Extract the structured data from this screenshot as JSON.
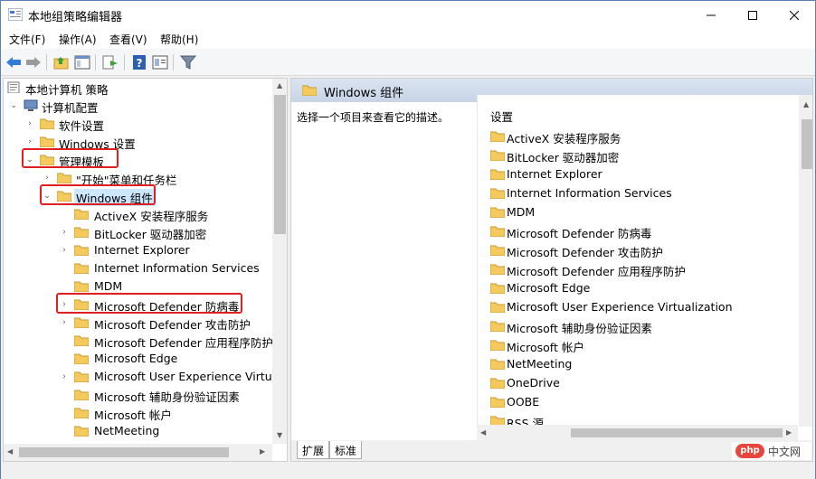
{
  "window": {
    "title": "本地组策略编辑器"
  },
  "menubar": {
    "items": [
      "文件(F)",
      "操作(A)",
      "查看(V)",
      "帮助(H)"
    ]
  },
  "toolbar": {
    "icons": [
      "back-icon",
      "forward-icon",
      "up-folder-icon",
      "show-hide-tree-icon",
      "export-icon",
      "help-icon",
      "properties-icon",
      "filter-icon"
    ]
  },
  "tree": {
    "items": [
      {
        "label": "本地计算机 策略",
        "icon": "computer-policy-icon"
      },
      {
        "label": "计算机配置",
        "icon": "computer-icon"
      },
      {
        "label": "软件设置"
      },
      {
        "label": "Windows 设置"
      },
      {
        "label": "管理模板"
      },
      {
        "label": "\"开始\"菜单和任务栏"
      },
      {
        "label": "Windows 组件"
      },
      {
        "label": "ActiveX 安装程序服务"
      },
      {
        "label": "BitLocker 驱动器加密"
      },
      {
        "label": "Internet Explorer"
      },
      {
        "label": "Internet Information Services"
      },
      {
        "label": "MDM"
      },
      {
        "label": "Microsoft Defender 防病毒"
      },
      {
        "label": "Microsoft Defender 攻击防护"
      },
      {
        "label": "Microsoft Defender 应用程序防护"
      },
      {
        "label": "Microsoft Edge"
      },
      {
        "label": "Microsoft User Experience Virtual"
      },
      {
        "label": "Microsoft 辅助身份验证因素"
      },
      {
        "label": "Microsoft 帐户"
      },
      {
        "label": "NetMeeting"
      }
    ]
  },
  "right_pane": {
    "header": "Windows 组件",
    "description": "选择一个项目来查看它的描述。",
    "column_header": "设置",
    "items": [
      "ActiveX 安装程序服务",
      "BitLocker 驱动器加密",
      "Internet Explorer",
      "Internet Information Services",
      "MDM",
      "Microsoft Defender 防病毒",
      "Microsoft Defender 攻击防护",
      "Microsoft Defender 应用程序防护",
      "Microsoft Edge",
      "Microsoft User Experience Virtualization",
      "Microsoft 辅助身份验证因素",
      "Microsoft 帐户",
      "NetMeeting",
      "OneDrive",
      "OOBE",
      "RSS 源"
    ]
  },
  "tabs": [
    "扩展",
    "标准"
  ],
  "watermark": {
    "logo": "php",
    "text": "中文网"
  },
  "colors": {
    "highlight_red": "#e02020",
    "folder_yellow": "#f4c95d",
    "header_blue": "#c7d4e6"
  }
}
